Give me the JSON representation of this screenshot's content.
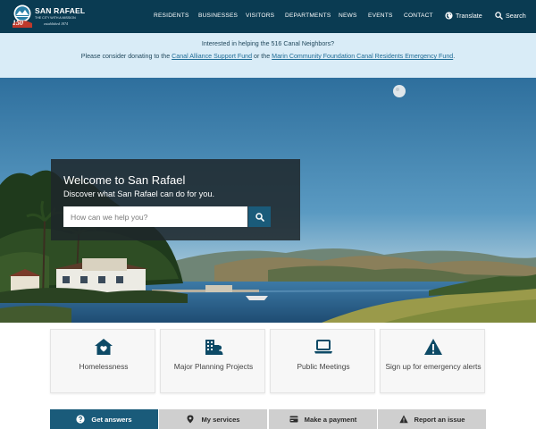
{
  "brand": {
    "name": "SAN RAFAEL",
    "tagline": "THE CITY WITH A MISSION",
    "established": "established 1874",
    "badge_number": "150"
  },
  "nav": {
    "items": [
      "RESIDENTS",
      "BUSINESSES",
      "VISITORS",
      "DEPARTMENTS",
      "NEWS",
      "EVENTS",
      "CONTACT"
    ],
    "translate_label": "Translate",
    "search_label": "Search"
  },
  "banner": {
    "line1": "Interested in helping the 516 Canal Neighbors?",
    "line2_prefix": "Please consider donating to the ",
    "link1": "Canal Alliance Support Fund",
    "line2_middle": " or the ",
    "link2": "Marin Community Foundation Canal Residents Emergency Fund",
    "line2_suffix": "."
  },
  "hero": {
    "title": "Welcome to San Rafael",
    "subtitle": "Discover what San Rafael can do for you.",
    "search_placeholder": "How can we help you?"
  },
  "cards": [
    {
      "label": "Homelessness",
      "icon": "home-heart-icon"
    },
    {
      "label": "Major Planning Projects",
      "icon": "city-buildings-icon"
    },
    {
      "label": "Public Meetings",
      "icon": "laptop-icon"
    },
    {
      "label": "Sign up for emergency alerts",
      "icon": "warning-icon"
    }
  ],
  "tabs": [
    {
      "label": "Get answers",
      "icon": "question-icon",
      "active": true
    },
    {
      "label": "My services",
      "icon": "map-pin-icon",
      "active": false
    },
    {
      "label": "Make a payment",
      "icon": "credit-card-icon",
      "active": false
    },
    {
      "label": "Report an issue",
      "icon": "warning-icon",
      "active": false
    }
  ],
  "colors": {
    "header_bg": "#0a3b52",
    "banner_bg": "#d9ecf7",
    "accent": "#1a5b7a",
    "icon": "#0d4a66"
  }
}
